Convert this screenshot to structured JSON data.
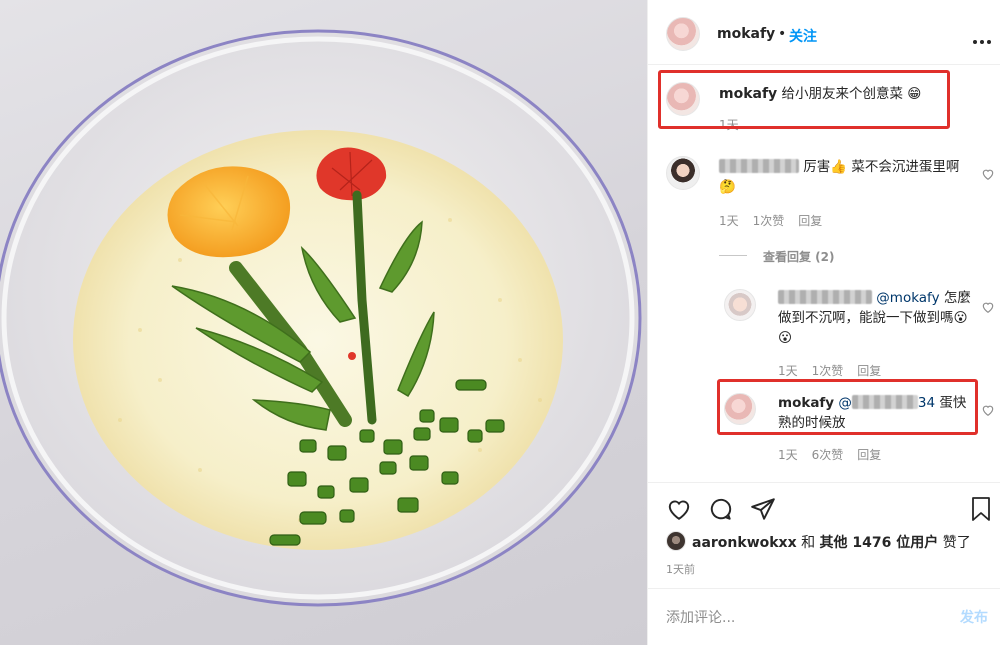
{
  "header": {
    "username": "mokafy",
    "follow_label": "关注",
    "more_icon": "more-horizontal-icon"
  },
  "caption": {
    "username": "mokafy",
    "text": "给小朋友来个创意菜",
    "emoji": "😁",
    "time": "1天"
  },
  "comments": [
    {
      "text": "厉害",
      "emoji1": "👍",
      "text2": "菜不会沉进蛋里啊",
      "emoji2": "🤔",
      "time": "1天",
      "likes": "1次赞",
      "reply": "回复"
    },
    {
      "view_replies": "查看回复 (2)"
    },
    {
      "mention": "@mokafy",
      "text": "怎麼做到不沉啊，能說一下做到嗎",
      "emoji": "😮😮",
      "time": "1天",
      "likes": "1次赞",
      "reply": "回复"
    },
    {
      "username": "mokafy",
      "mention": "@",
      "mention_suffix": "34",
      "text": "蛋快熟的时候放",
      "time": "1天",
      "likes": "6次赞",
      "reply": "回复"
    }
  ],
  "likes_line": {
    "user": "aaronkwokxx",
    "and": "和",
    "others": "其他 1476 位用户",
    "suffix": "赞了"
  },
  "post_time": "1天前",
  "comment_box": {
    "placeholder": "添加评论...",
    "post_label": "发布"
  },
  "colors": {
    "accent": "#0095f6",
    "highlight_box": "#e0302b",
    "muted": "#8e8e8e"
  }
}
